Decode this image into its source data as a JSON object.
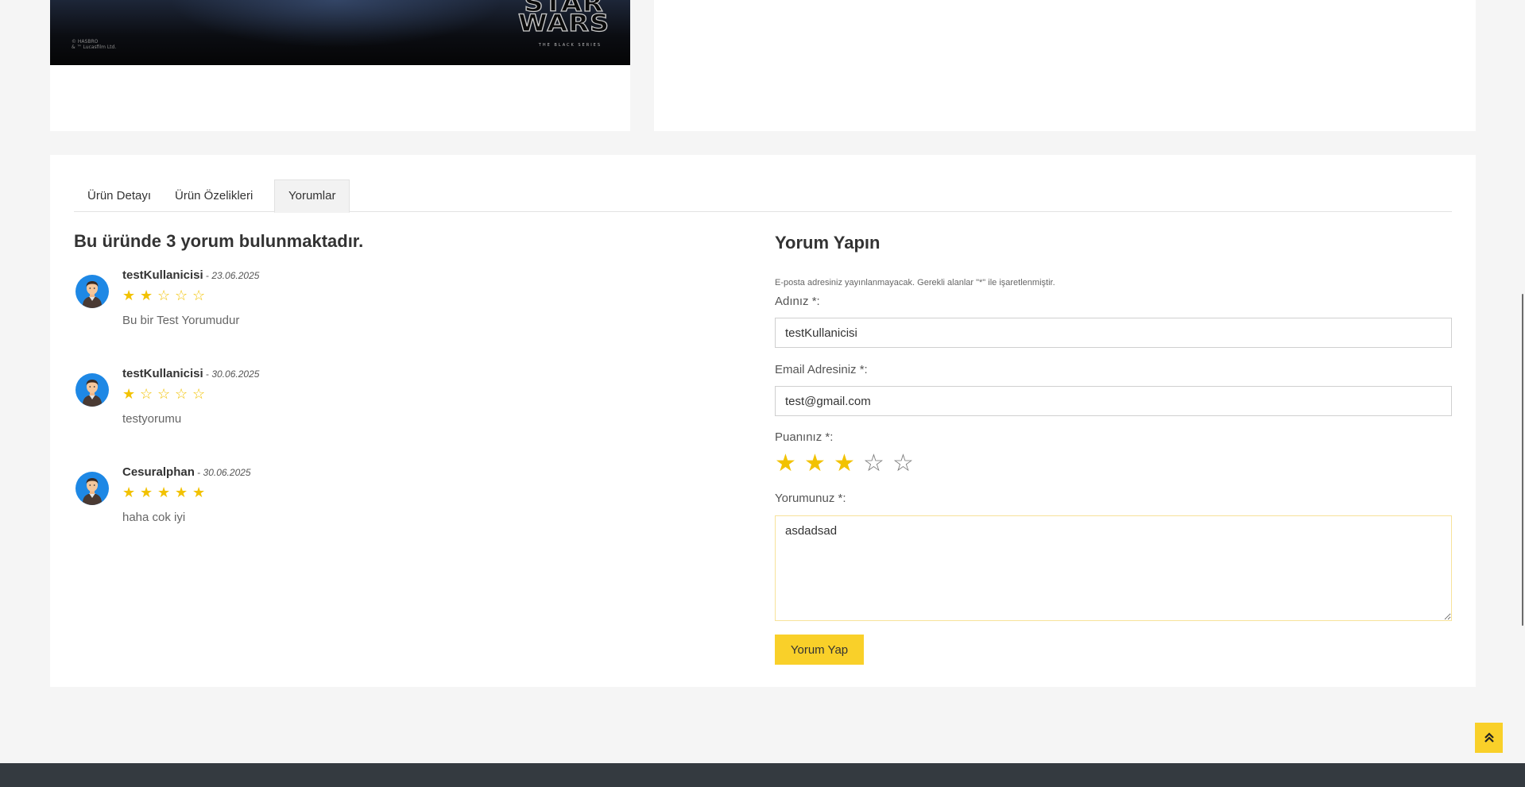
{
  "product_image": {
    "copyright": "© HASBRO\n& ™ Lucasfilm Ltd.",
    "logo_line1": "STAR",
    "logo_line2": "WARS",
    "logo_sub": "THE BLACK SERIES"
  },
  "tabs": [
    {
      "label": "Ürün Detayı",
      "active": false
    },
    {
      "label": "Ürün Özelikleri",
      "active": false
    },
    {
      "label": "Yorumlar",
      "active": true
    }
  ],
  "reviews_section": {
    "heading": "Bu üründe 3 yorum bulunmaktadır.",
    "reviews": [
      {
        "name": "testKullanicisi",
        "separator": "-",
        "date": "23.06.2025",
        "rating": 2,
        "max_rating": 5,
        "text": "Bu bir Test Yorumudur"
      },
      {
        "name": "testKullanicisi",
        "separator": "-",
        "date": "30.06.2025",
        "rating": 1,
        "max_rating": 5,
        "text": "testyorumu"
      },
      {
        "name": "Cesuralphan",
        "separator": "-",
        "date": "30.06.2025",
        "rating": 5,
        "max_rating": 5,
        "text": "haha cok iyi"
      }
    ]
  },
  "comment_form": {
    "title": "Yorum Yapın",
    "note": "E-posta adresiniz yayınlanmayacak. Gerekli alanlar \"*\" ile işaretlenmiştir.",
    "name_label": "Adınız *:",
    "name_value": "testKullanicisi",
    "email_label": "Email Adresiniz *:",
    "email_value": "test@gmail.com",
    "rating_label": "Puanınız *:",
    "rating_value": 3,
    "rating_max": 5,
    "comment_label": "Yorumunuz *:",
    "comment_value": "asdadsad",
    "submit_label": "Yorum Yap"
  },
  "scroll_top": {
    "icon": "double-chevron-up-icon",
    "glyph": "⌃"
  },
  "colors": {
    "accent": "#f9d029",
    "star": "#f2c200",
    "footer": "#343a40",
    "avatar_bg": "#1e88e5"
  }
}
